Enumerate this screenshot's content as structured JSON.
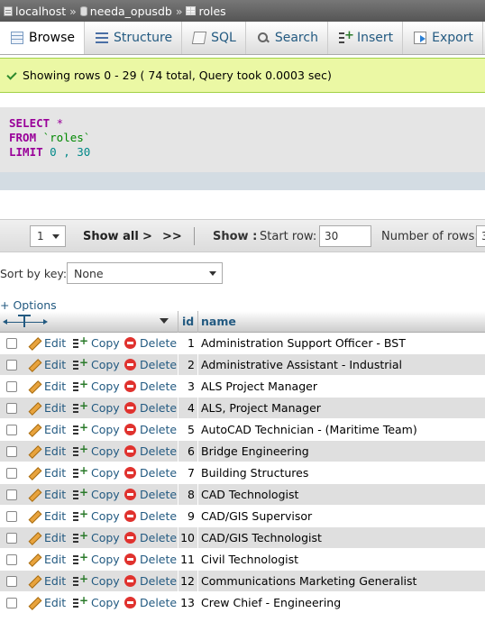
{
  "breadcrumb": {
    "server": "localhost",
    "database": "needa_opusdb",
    "table": "roles",
    "separator": "»"
  },
  "tabs": [
    {
      "label": "Browse",
      "icon": "browse-icon",
      "active": true
    },
    {
      "label": "Structure",
      "icon": "structure-icon"
    },
    {
      "label": "SQL",
      "icon": "sql-icon"
    },
    {
      "label": "Search",
      "icon": "search-icon"
    },
    {
      "label": "Insert",
      "icon": "insert-icon"
    },
    {
      "label": "Export",
      "icon": "export-icon"
    }
  ],
  "success": {
    "message": "Showing rows 0 - 29 ( 74 total, Query took 0.0003 sec)"
  },
  "sql": {
    "select_kw": "SELECT",
    "select_rest": " *",
    "from_kw": "FROM",
    "from_rest": " `roles`",
    "limit_kw": "LIMIT",
    "limit_rest": " 0 , 30"
  },
  "navigation": {
    "page": "1",
    "show_all": "Show all",
    "next": ">",
    "last": ">>",
    "show_label": "Show :",
    "start_row_label": "Start row:",
    "start_row_value": "30",
    "num_rows_label": "Number of rows:",
    "num_rows_value": "3"
  },
  "sort": {
    "label": "Sort by key:",
    "value": "None"
  },
  "options_link": "+ Options",
  "table": {
    "col_id": "id",
    "col_name": "name",
    "edit_label": "Edit",
    "copy_label": "Copy",
    "delete_label": "Delete",
    "rows": [
      {
        "id": "1",
        "name": "Administration Support Officer - BST"
      },
      {
        "id": "2",
        "name": "Administrative Assistant - Industrial"
      },
      {
        "id": "3",
        "name": "ALS Project Manager"
      },
      {
        "id": "4",
        "name": "ALS, Project Manager"
      },
      {
        "id": "5",
        "name": "AutoCAD Technician - (Maritime Team)"
      },
      {
        "id": "6",
        "name": "Bridge Engineering"
      },
      {
        "id": "7",
        "name": "Building Structures"
      },
      {
        "id": "8",
        "name": "CAD Technologist"
      },
      {
        "id": "9",
        "name": "CAD/GIS Supervisor"
      },
      {
        "id": "10",
        "name": "CAD/GIS Technologist"
      },
      {
        "id": "11",
        "name": "Civil Technologist"
      },
      {
        "id": "12",
        "name": "Communications Marketing Generalist"
      },
      {
        "id": "13",
        "name": "Crew Chief - Engineering"
      }
    ]
  },
  "colors": {
    "link": "#235a81",
    "success_bg": "#ebf8a4",
    "sql_keyword": "#990099",
    "row_alt": "#dfdfdf"
  }
}
